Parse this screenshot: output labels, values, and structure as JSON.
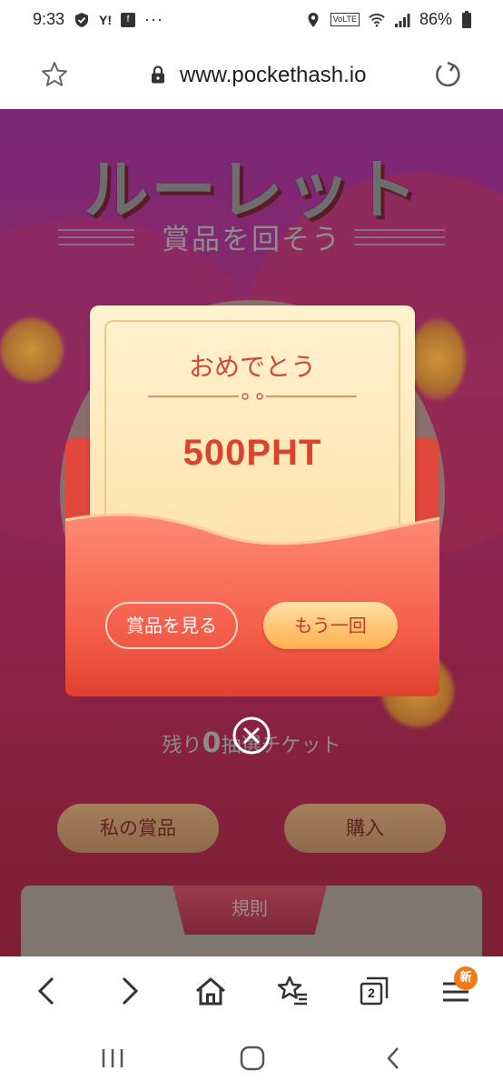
{
  "status_bar": {
    "time": "9:33",
    "battery": "86%",
    "app_icons": [
      "shield-icon",
      "yahoo-icon",
      "flipboard-icon",
      "more-dots-icon"
    ],
    "system_icons": [
      "location-icon",
      "volte-icon",
      "wifi-icon",
      "signal-icon",
      "battery-icon"
    ],
    "volte_label": "VoLTE"
  },
  "url_bar": {
    "url": "www.pockethash.io"
  },
  "page": {
    "title": "ルーレット",
    "subtitle": "賞品を回そう",
    "remaining_prefix": "残り",
    "remaining_count": "0",
    "remaining_suffix": "抽選チケット",
    "my_prizes_button": "私の賞品",
    "buy_button": "購入",
    "rules_tab": "規則"
  },
  "modal": {
    "congrats": "おめでとう",
    "prize": "500PHT",
    "view_prizes_button": "賞品を見る",
    "again_button": "もう一回",
    "colors": {
      "envelope": "#e2473c",
      "letter": "#ffe7b4",
      "accent": "#d9432f"
    }
  },
  "toolbar": {
    "items": [
      "back-icon",
      "forward-icon",
      "home-icon",
      "bookmarks-icon",
      "tabs-icon",
      "menu-icon"
    ],
    "tabs_count": "2",
    "menu_badge": "新"
  },
  "nav_bar": {
    "items": [
      "recent-apps-icon",
      "home-icon",
      "back-icon"
    ]
  }
}
